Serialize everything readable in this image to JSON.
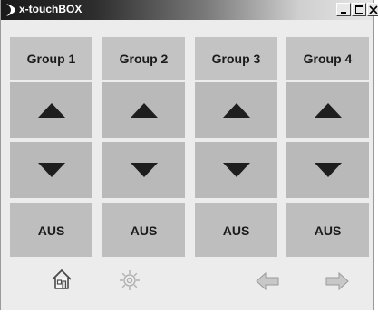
{
  "window": {
    "title": "x-touchBOX"
  },
  "groups": [
    {
      "header": "Group 1",
      "off_label": "AUS"
    },
    {
      "header": "Group 2",
      "off_label": "AUS"
    },
    {
      "header": "Group 3",
      "off_label": "AUS"
    },
    {
      "header": "Group 4",
      "off_label": "AUS"
    }
  ],
  "icons": {
    "app": "arrow-logo-icon",
    "up": "triangle-up-icon",
    "down": "triangle-down-icon",
    "home": "home-icon",
    "settings": "gear-icon",
    "back": "arrow-left-icon",
    "forward": "arrow-right-icon"
  },
  "colors": {
    "tile": "#b9b9b9",
    "arrow": "#1e1e1e",
    "window_bg": "#ececec"
  }
}
